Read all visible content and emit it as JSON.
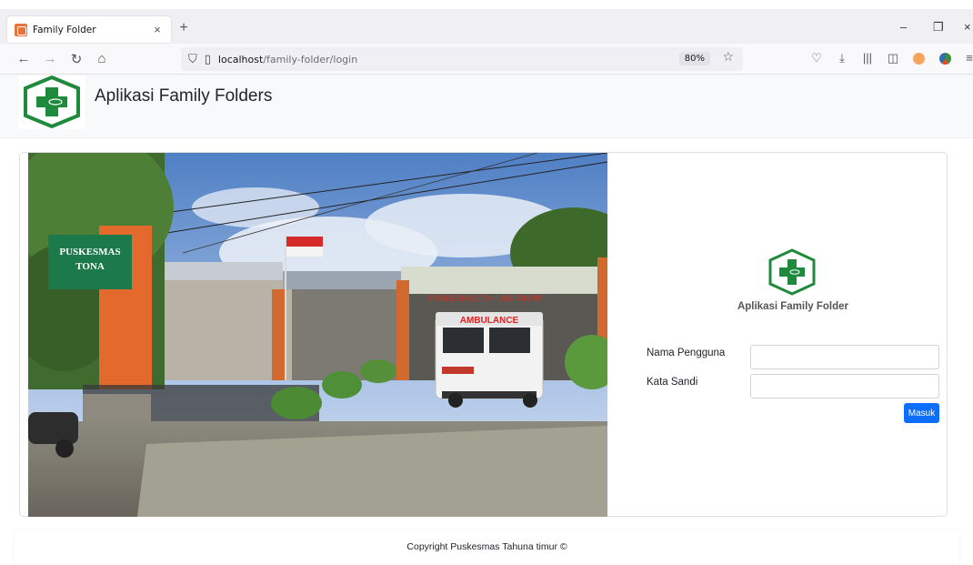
{
  "browser": {
    "tab_title": "Family Folder",
    "tab_close": "×",
    "new_tab": "+",
    "url_host": "localhost",
    "url_path": "/family-folder/login",
    "zoom": "80%",
    "controls": {
      "minimize": "–",
      "restore": "❐",
      "close": "×"
    },
    "icons": [
      "back-icon",
      "forward-icon",
      "reload-icon",
      "home-icon",
      "shield-icon",
      "page-icon",
      "star-icon",
      "pocket-icon",
      "download-icon",
      "library-icon",
      "sidebar-icon",
      "extension-icon",
      "globe-icon",
      "menu-icon"
    ]
  },
  "header": {
    "title": "Aplikasi Family Folders"
  },
  "login": {
    "heading": "Aplikasi Family Folder",
    "username_label": "Nama Pengguna",
    "username_value": "",
    "password_label": "Kata Sandi",
    "password_value": "",
    "submit_label": "Masuk"
  },
  "photo": {
    "sign_title": "PUSKESMAS",
    "sign_subtitle": "TONA",
    "ambulance_label": "AMBULANCE",
    "building_label": "PUSKESMAS TAHUNA TIMUR"
  },
  "footer": {
    "copyright": "Copyright Puskesmas Tahuna timur ©"
  },
  "colors": {
    "brand_green": "#1e8a3c",
    "primary_button": "#0d6efd",
    "header_bg": "#f8f9fa"
  }
}
